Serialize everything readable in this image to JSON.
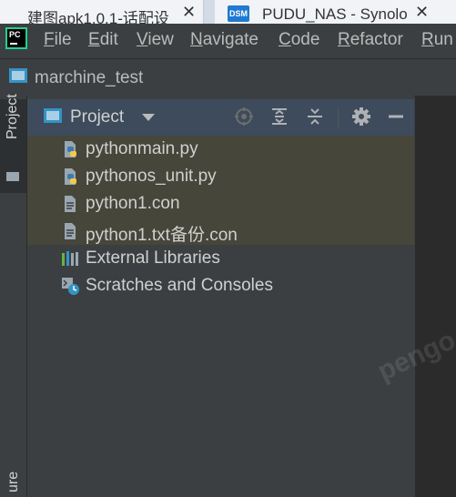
{
  "browser_tabs": [
    {
      "title": "建图apk1.0.1-话配设",
      "close": "✕"
    },
    {
      "badge": "DSM",
      "title": "PUDU_NAS - Synolo",
      "close": "✕"
    }
  ],
  "ide": {
    "logo_text": "PC",
    "menu": [
      "File",
      "Edit",
      "View",
      "Navigate",
      "Code",
      "Refactor",
      "Run"
    ],
    "breadcrumb": "marchine_test",
    "left_stripe": {
      "tab": "Project",
      "bottom": "ure"
    },
    "panel": {
      "title": "Project",
      "toolbar_icons": [
        "locate-icon",
        "expand-all-icon",
        "collapse-all-icon",
        "settings-gear-icon",
        "minimize-icon"
      ]
    },
    "tree": [
      {
        "label": "pythonmain.py",
        "icon": "python-file-icon",
        "selected": true
      },
      {
        "label": "pythonos_unit.py",
        "icon": "python-file-icon",
        "selected": true
      },
      {
        "label": "python1.con",
        "icon": "text-file-icon",
        "selected": true
      },
      {
        "label": "python1.txt备份.con",
        "icon": "text-file-icon",
        "selected": true
      },
      {
        "label": "External Libraries",
        "icon": "libraries-icon",
        "selected": false
      },
      {
        "label": "Scratches and Consoles",
        "icon": "scratches-icon",
        "selected": false
      }
    ]
  },
  "watermark": "pengo",
  "colors": {
    "background": "#3c3f41",
    "editor": "#2b2b2b",
    "selection": "#47463a",
    "panel_header": "#3d4b5c",
    "text": "#bbbbbb"
  }
}
